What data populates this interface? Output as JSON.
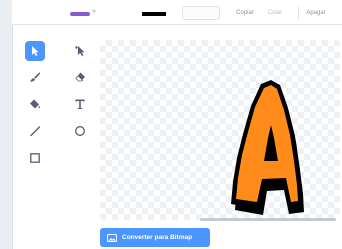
{
  "toolbar": {
    "copy_label": "Copiar",
    "paste_label": "Colar",
    "delete_label": "Apagar"
  },
  "tools": [
    {
      "name": "select",
      "icon": "arrow-cursor-icon",
      "selected": true
    },
    {
      "name": "reshape",
      "icon": "reshape-cursor-icon",
      "selected": false
    },
    {
      "name": "brush",
      "icon": "brush-icon",
      "selected": false
    },
    {
      "name": "eraser",
      "icon": "eraser-icon",
      "selected": false
    },
    {
      "name": "fill",
      "icon": "paint-bucket-icon",
      "selected": false
    },
    {
      "name": "text",
      "icon": "text-icon",
      "selected": false
    },
    {
      "name": "line",
      "icon": "line-icon",
      "selected": false
    },
    {
      "name": "circle",
      "icon": "circle-icon",
      "selected": false
    },
    {
      "name": "rectangle",
      "icon": "rectangle-icon",
      "selected": false
    }
  ],
  "canvas": {
    "sprite_letter": "A"
  },
  "bitmap_button": {
    "label": "Converter para Bitmap",
    "icon": "image-icon"
  },
  "colors": {
    "accent": "#4c97ff",
    "fill_swatch": "#855cd6",
    "outline_swatch": "#000000",
    "letter_fill": "#ff8c1a",
    "letter_outline": "#000000"
  }
}
